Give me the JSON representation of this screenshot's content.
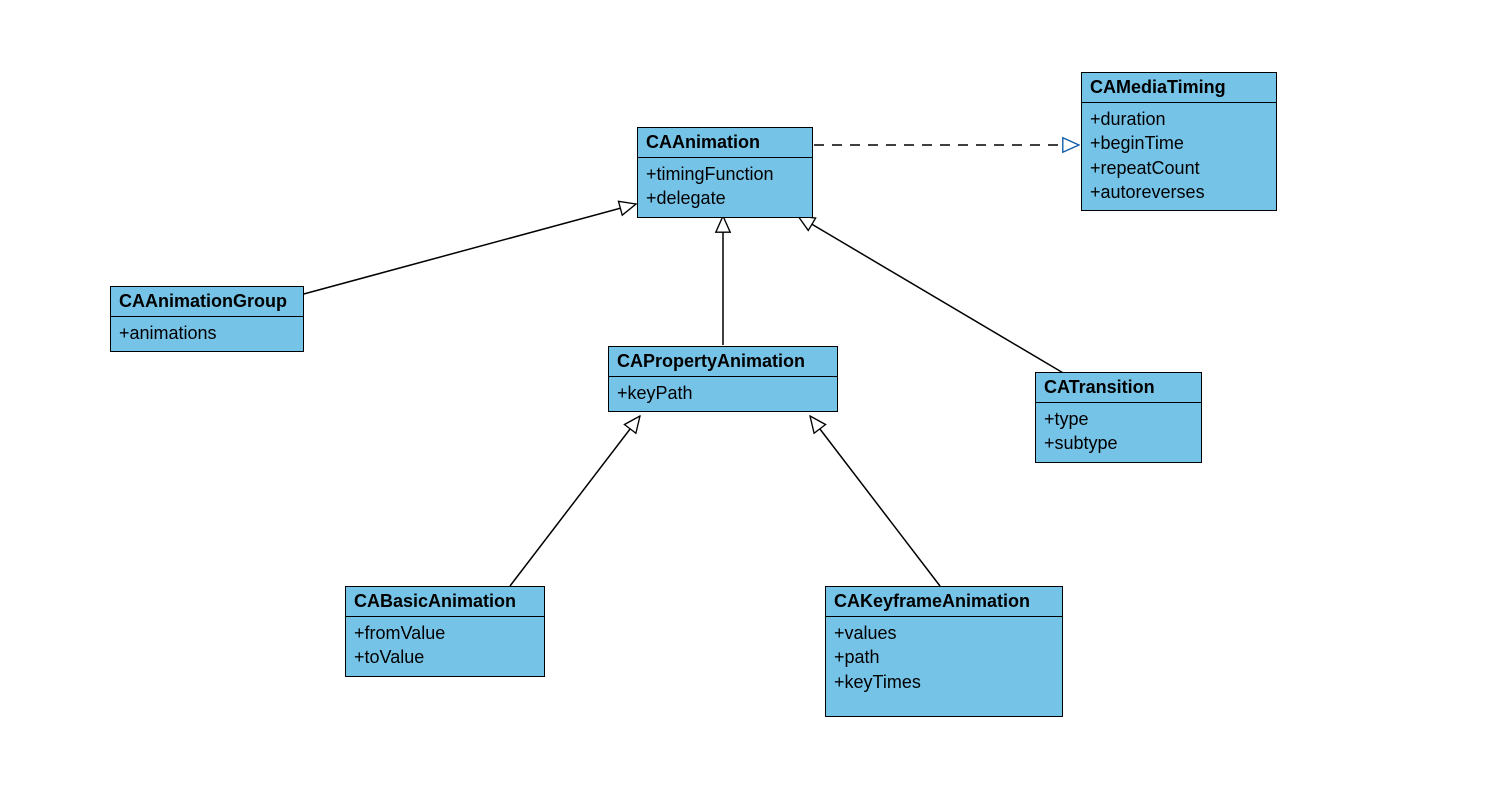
{
  "colors": {
    "boxFill": "#76c3e8",
    "boxStroke": "#000000"
  },
  "classes": {
    "CAMediaTiming": {
      "name": "CAMediaTiming",
      "attrs": [
        "+duration",
        "+beginTime",
        "+repeatCount",
        "+autoreverses"
      ]
    },
    "CAAnimation": {
      "name": "CAAnimation",
      "attrs": [
        "+timingFunction",
        "+delegate"
      ]
    },
    "CAAnimationGroup": {
      "name": "CAAnimationGroup",
      "attrs": [
        "+animations"
      ]
    },
    "CAPropertyAnimation": {
      "name": "CAPropertyAnimation",
      "attrs": [
        "+keyPath"
      ]
    },
    "CATransition": {
      "name": "CATransition",
      "attrs": [
        "+type",
        "+subtype"
      ]
    },
    "CABasicAnimation": {
      "name": "CABasicAnimation",
      "attrs": [
        "+fromValue",
        "+toValue"
      ]
    },
    "CAKeyframeAnimation": {
      "name": "CAKeyframeAnimation",
      "attrs": [
        "+values",
        "+path",
        "+keyTimes"
      ]
    }
  },
  "relationships": [
    {
      "from": "CAAnimation",
      "to": "CAMediaTiming",
      "type": "realization"
    },
    {
      "from": "CAAnimationGroup",
      "to": "CAAnimation",
      "type": "generalization"
    },
    {
      "from": "CAPropertyAnimation",
      "to": "CAAnimation",
      "type": "generalization"
    },
    {
      "from": "CATransition",
      "to": "CAAnimation",
      "type": "generalization"
    },
    {
      "from": "CABasicAnimation",
      "to": "CAPropertyAnimation",
      "type": "generalization"
    },
    {
      "from": "CAKeyframeAnimation",
      "to": "CAPropertyAnimation",
      "type": "generalization"
    }
  ]
}
